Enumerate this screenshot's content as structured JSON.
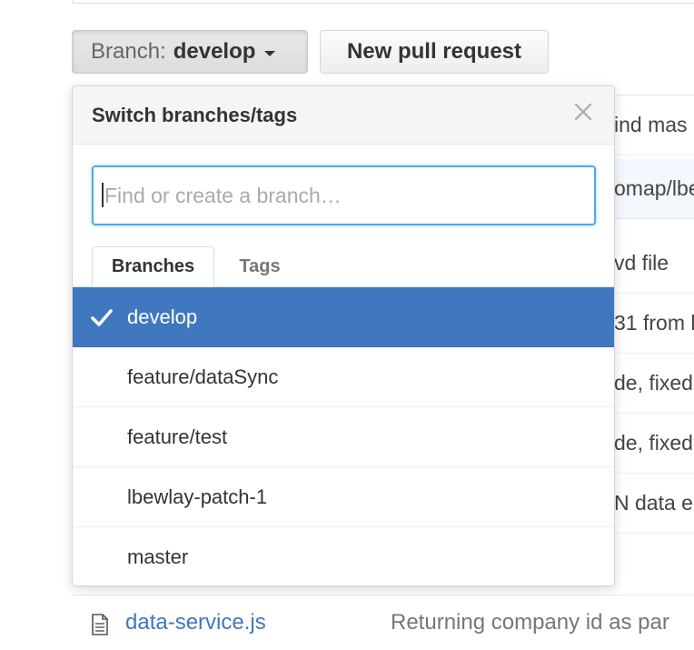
{
  "toolbar": {
    "branch_prefix": "Branch:",
    "branch_name": "develop",
    "new_pr_label": "New pull request"
  },
  "background_rows": [
    "ind mas",
    "omap/lbe",
    "vd file",
    "31 from l",
    "de, fixed",
    "de, fixed",
    "N data e"
  ],
  "bottom_file": {
    "name": "data-service.js",
    "commit": "Returning company id as par"
  },
  "dropdown": {
    "title": "Switch branches/tags",
    "filter_placeholder": "Find or create a branch…",
    "tabs": [
      "Branches",
      "Tags"
    ],
    "selected_tab": "Branches",
    "items": [
      "develop",
      "feature/dataSync",
      "feature/test",
      "lbewlay-patch-1",
      "master"
    ],
    "selected_item": "develop"
  },
  "colors": {
    "accent": "#4078c0",
    "focus": "#51a7e8",
    "link": "#4078c0"
  },
  "icons": {
    "close": "close-icon",
    "check": "check-icon",
    "file": "file-icon",
    "caret": "caret-down-icon"
  }
}
